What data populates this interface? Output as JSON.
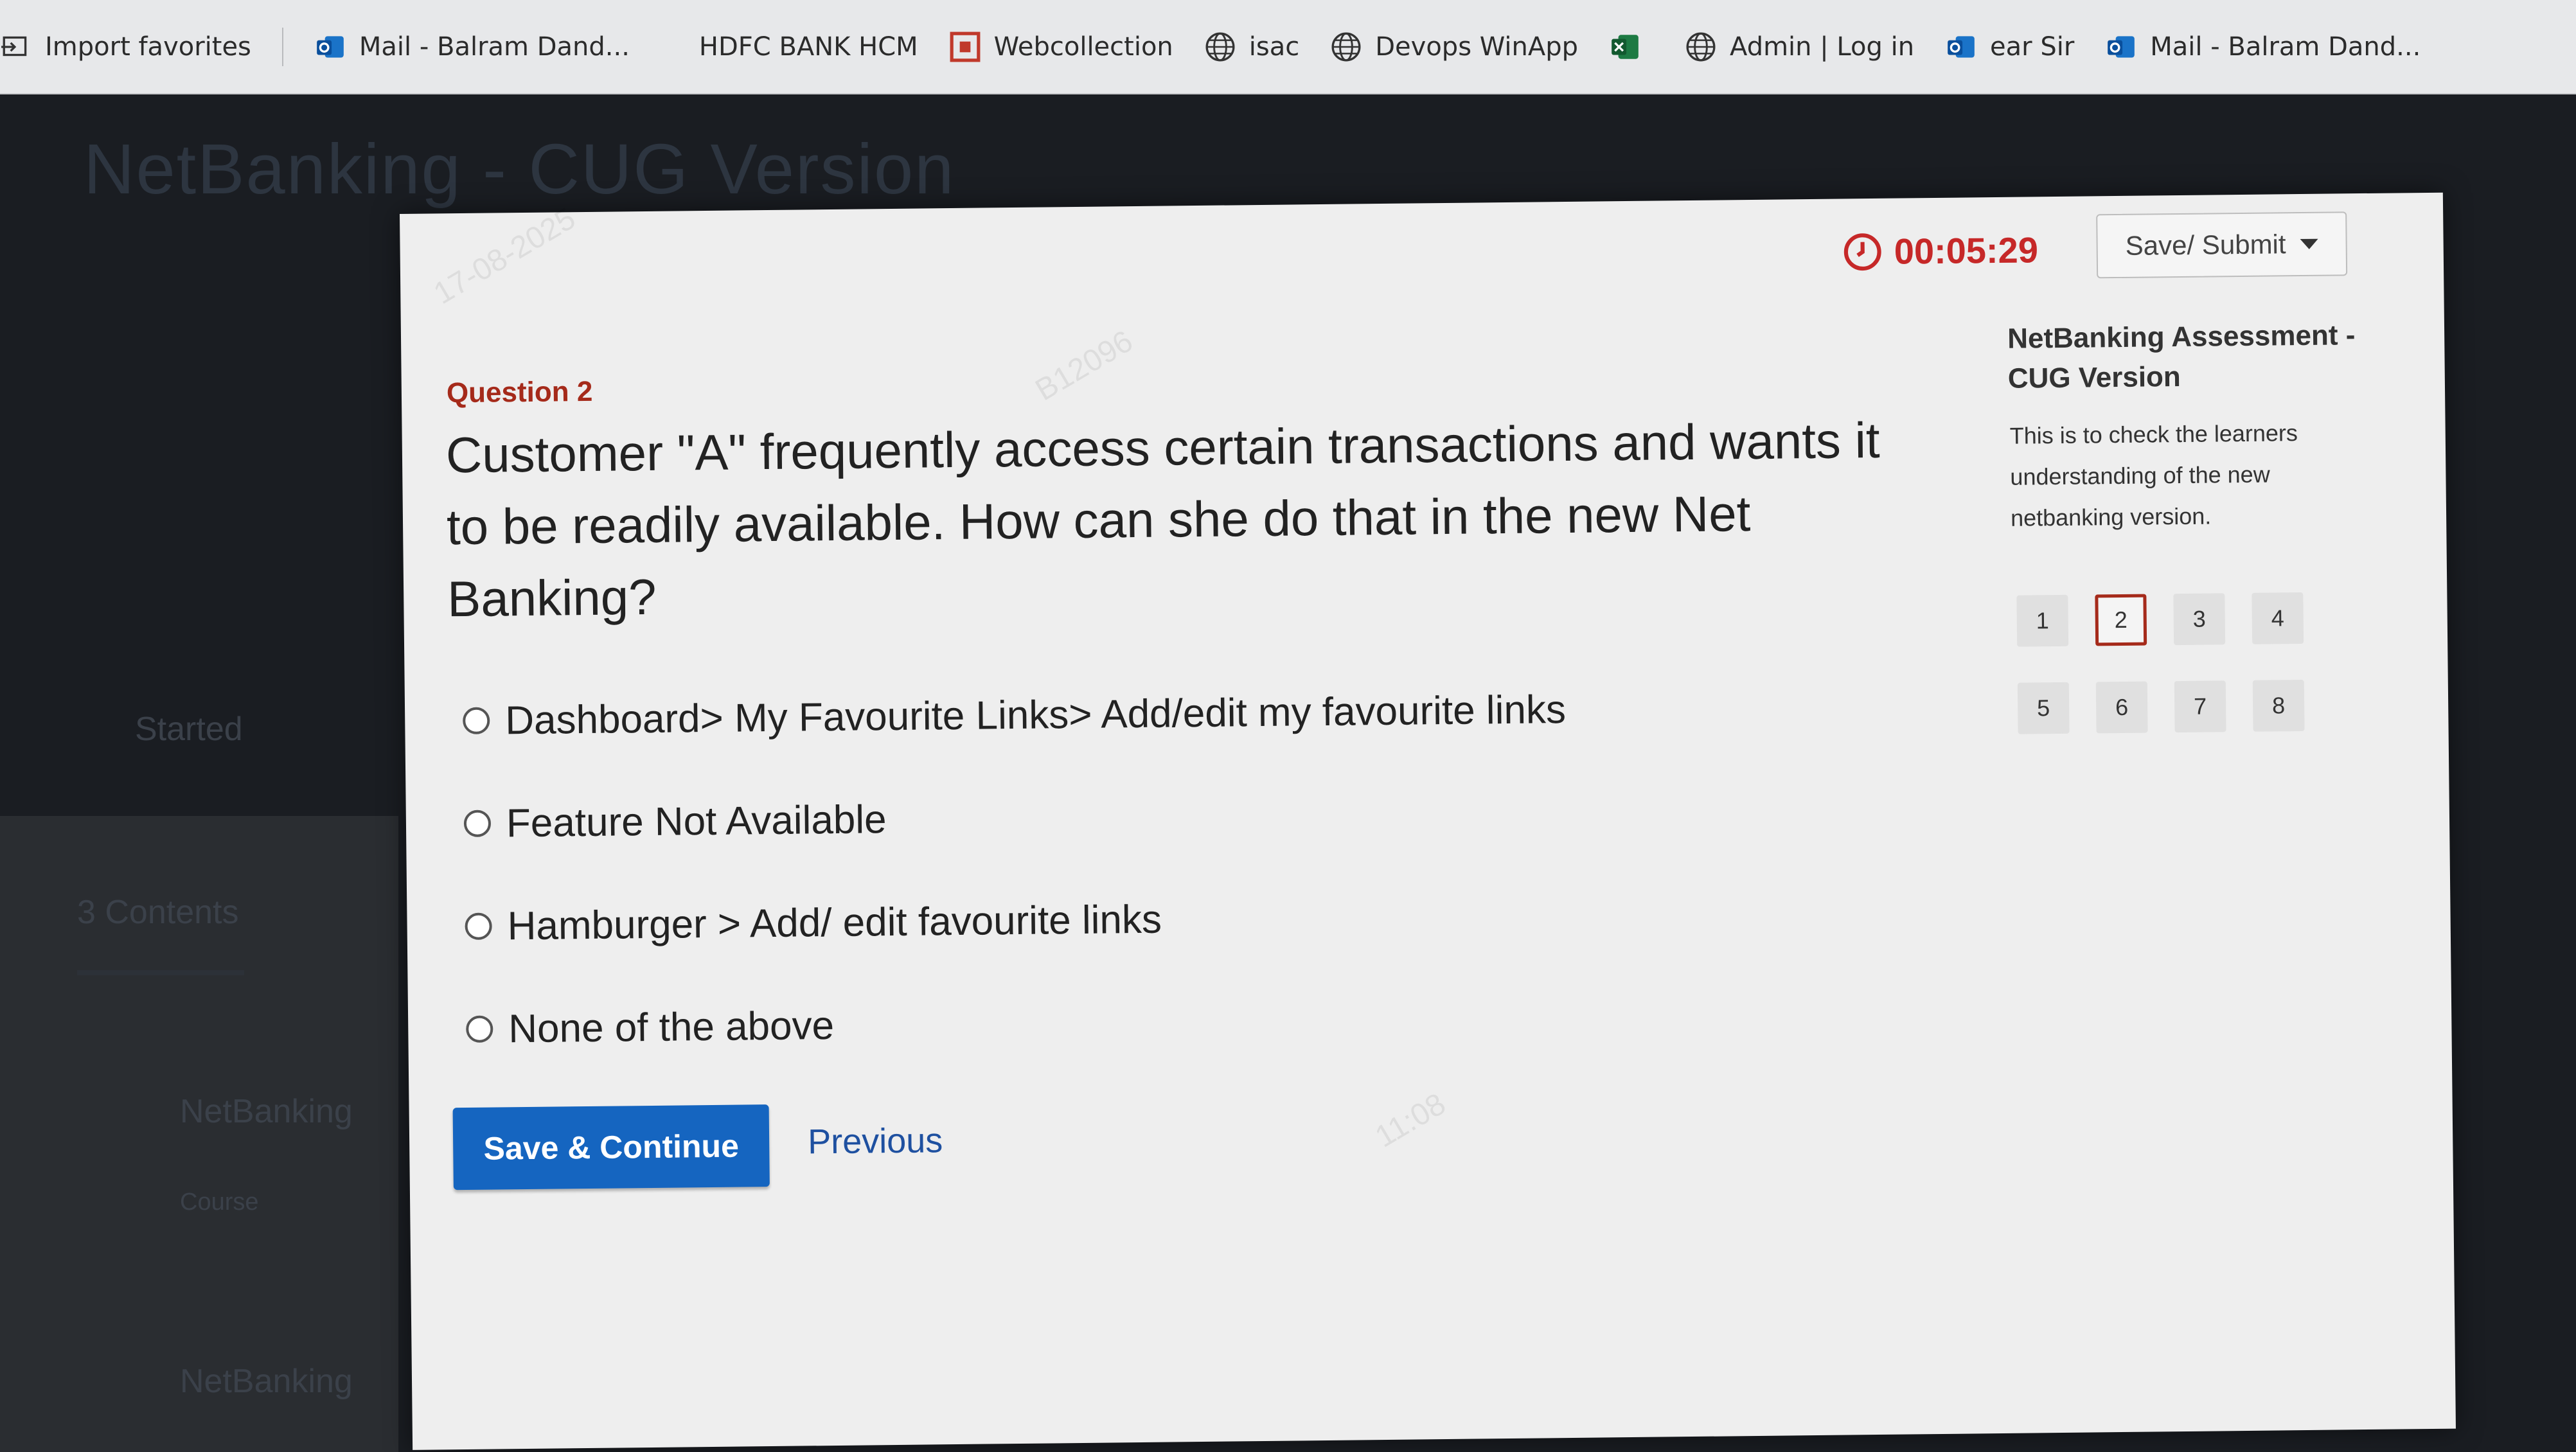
{
  "bookmarks": [
    {
      "label": "Import favorites",
      "icon": "import-icon"
    },
    {
      "label": "Mail - Balram Dand...",
      "icon": "outlook-icon"
    },
    {
      "label": "HDFC BANK HCM",
      "icon": ""
    },
    {
      "label": "Webcollection",
      "icon": "webcollection-icon"
    },
    {
      "label": "isac",
      "icon": "globe-icon"
    },
    {
      "label": "Devops WinApp",
      "icon": "globe-icon"
    },
    {
      "label": "",
      "icon": "excel-icon"
    },
    {
      "label": "Admin | Log in",
      "icon": "globe-icon"
    },
    {
      "label": "ear Sir",
      "icon": "outlook-icon"
    },
    {
      "label": "Mail - Balram Dand...",
      "icon": "outlook-icon"
    }
  ],
  "background": {
    "title": "NetBanking - CUG Version",
    "started": "Started",
    "contents": "3 Contents",
    "nav1": "NetBanking",
    "nav2": "NetBanking",
    "course": "Course"
  },
  "timer": "00:05:29",
  "save_submit_label": "Save/ Submit",
  "question": {
    "label": "Question 2",
    "text": "Customer \"A\" frequently access certain transactions and wants it to be readily available. How can she do that in the new Net Banking?",
    "options": [
      "Dashboard> My Favourite Links> Add/edit my favourite links",
      "Feature Not Available",
      "Hamburger > Add/ edit favourite links",
      "None of the above"
    ]
  },
  "buttons": {
    "save_continue": "Save & Continue",
    "previous": "Previous"
  },
  "assessment": {
    "title": "NetBanking Assessment - CUG Version",
    "description": "This is to check the learners understanding of the new netbanking version.",
    "question_numbers": [
      "1",
      "2",
      "3",
      "4",
      "5",
      "6",
      "7",
      "8"
    ],
    "current": "2"
  },
  "watermark": {
    "date": "17-08-2025",
    "id": "B12096",
    "time": "11:08"
  },
  "colors": {
    "accent_red": "#a52a1a",
    "button_blue": "#1565c0",
    "link_blue": "#1e50a0",
    "timer_red": "#c62828"
  }
}
